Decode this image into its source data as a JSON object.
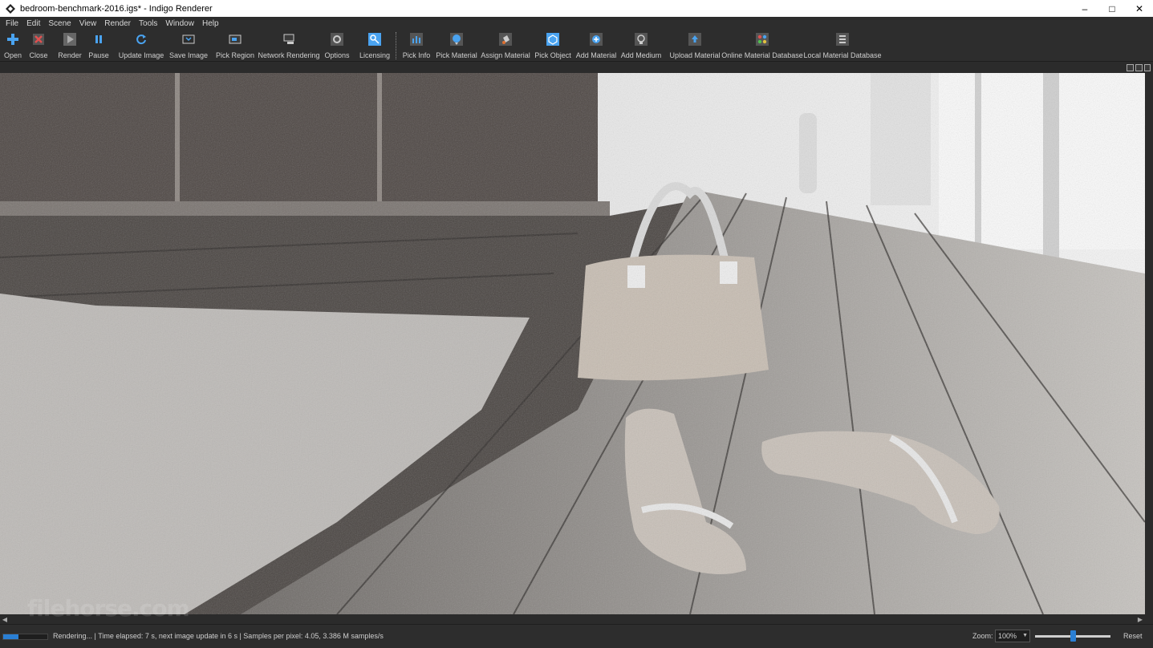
{
  "window": {
    "title": "bedroom-benchmark-2016.igs* - Indigo Renderer",
    "icon": "indigo-diamond-icon",
    "controls": [
      "minimize",
      "maximize",
      "close"
    ]
  },
  "menu": [
    "File",
    "Edit",
    "Scene",
    "View",
    "Render",
    "Tools",
    "Window",
    "Help"
  ],
  "toolbar": {
    "tools": [
      {
        "label": "Open",
        "icon": "plus-icon"
      },
      {
        "label": "Close",
        "icon": "close-x-icon"
      },
      {
        "label": "Render",
        "icon": "play-icon"
      },
      {
        "label": "Pause",
        "icon": "pause-icon"
      },
      {
        "label": "Update Image",
        "icon": "refresh-icon"
      },
      {
        "label": "Save Image",
        "icon": "save-image-icon"
      },
      {
        "label": "Pick Region",
        "icon": "region-icon"
      },
      {
        "label": "Network Rendering",
        "icon": "network-icon"
      },
      {
        "label": "Options",
        "icon": "gear-icon"
      },
      {
        "label": "Licensing",
        "icon": "key-icon"
      },
      {
        "label": "Pick Info",
        "icon": "bar-chart-icon"
      },
      {
        "label": "Pick Material",
        "icon": "pick-material-icon"
      },
      {
        "label": "Assign Material",
        "icon": "paint-bucket-icon"
      },
      {
        "label": "Pick Object",
        "icon": "cube-icon"
      },
      {
        "label": "Add Material",
        "icon": "add-material-icon"
      },
      {
        "label": "Add Medium",
        "icon": "bulb-icon"
      },
      {
        "label": "Upload Material",
        "icon": "upload-icon"
      },
      {
        "label": "Online Material Database",
        "icon": "dots-grid-icon"
      },
      {
        "label": "Local Material Database",
        "icon": "database-icon"
      }
    ]
  },
  "status": {
    "text": "Rendering... | Time elapsed: 7 s, next image update in 6 s | Samples per pixel: 4.05, 3.386 M samples/s",
    "progress": 0.35,
    "zoom_label": "Zoom:",
    "zoom_value": "100%",
    "zoom_slider_fraction": 0.5,
    "reset_label": "Reset"
  },
  "colors": {
    "accent": "#2a7fd4",
    "toolbar_bg": "#2d2d2d",
    "floor_dark": "#4a4542",
    "floor_light": "#b9b6b2"
  }
}
